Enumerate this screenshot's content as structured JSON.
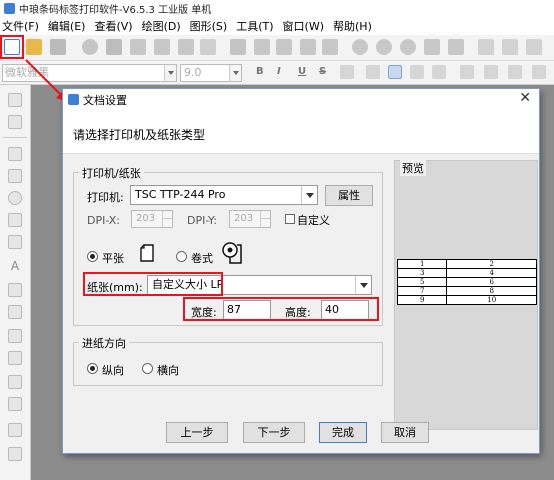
{
  "app": {
    "title": "中琅条码标签打印软件-V6.5.3 工业版 单机"
  },
  "menu": [
    "文件(F)",
    "编辑(E)",
    "查看(V)",
    "绘图(D)",
    "图形(S)",
    "工具(T)",
    "窗口(W)",
    "帮助(H)"
  ],
  "toolbar2": {
    "font": "微软雅黑",
    "size": "9.0",
    "format_buttons": [
      "B",
      "I",
      "U",
      "S"
    ]
  },
  "dialog": {
    "title": "文档设置",
    "header": "请选择打印机及纸张类型",
    "printer_group": {
      "label": "打印机/纸张",
      "printer_label": "打印机:",
      "printer_value": "TSC TTP-244 Pro",
      "properties_button": "属性",
      "dpix_label": "DPI-X:",
      "dpix_value": "203",
      "dpiy_label": "DPI-Y:",
      "dpiy_value": "203",
      "custom_label": "自定义",
      "sheet_label": "平张",
      "roll_label": "卷式",
      "paper_label": "纸张(mm):",
      "paper_value": "自定义大小 LP",
      "width_label": "宽度:",
      "width_value": "87",
      "height_label": "高度:",
      "height_value": "40"
    },
    "feed_group": {
      "label": "进纸方向",
      "portrait": "纵向",
      "landscape": "横向"
    },
    "preview_label": "预览",
    "preview_rows": [
      [
        "1",
        "2"
      ],
      [
        "3",
        "4"
      ],
      [
        "5",
        "6"
      ],
      [
        "7",
        "8"
      ],
      [
        "9",
        "10"
      ]
    ],
    "buttons": {
      "prev": "上一步",
      "next": "下一步",
      "finish": "完成",
      "cancel": "取消"
    }
  },
  "colors": {
    "highlight": "#e8141e",
    "accent": "#3c7fd6"
  }
}
